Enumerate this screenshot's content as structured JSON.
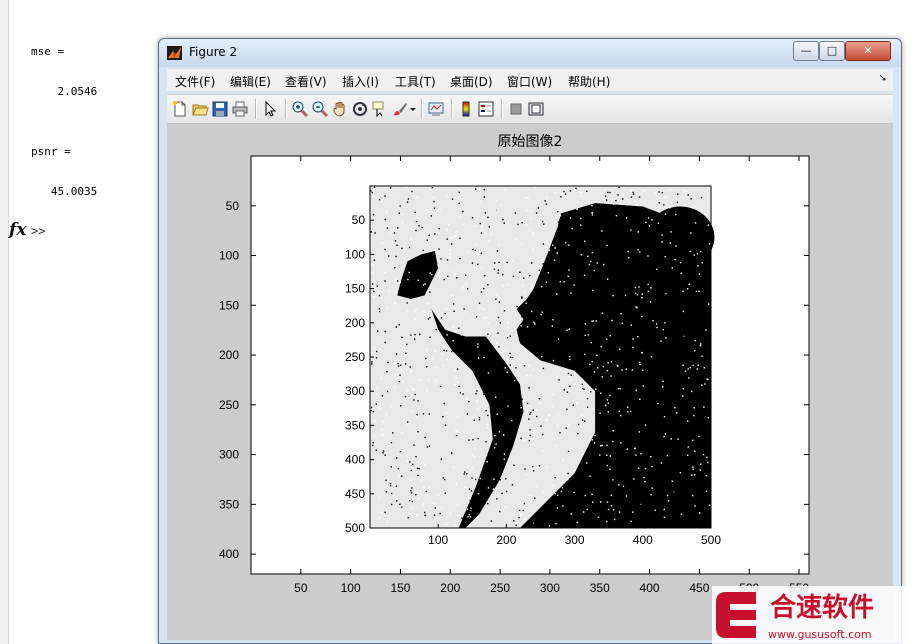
{
  "command_window": {
    "lines": [
      {
        "text": "mse ="
      },
      {
        "text": "    2.0546"
      },
      {
        "text": "psnr ="
      },
      {
        "text": "   45.0035"
      }
    ],
    "fx_label": "fx",
    "prompt": ">>"
  },
  "figure": {
    "title": "Figure 2",
    "menus": [
      "文件(F)",
      "编辑(E)",
      "查看(V)",
      "插入(I)",
      "工具(T)",
      "桌面(D)",
      "窗口(W)",
      "帮助(H)"
    ],
    "toolbar_icons": [
      "new-figure-icon",
      "open-file-icon",
      "save-icon",
      "print-icon",
      "pointer-icon",
      "zoom-in-icon",
      "zoom-out-icon",
      "pan-icon",
      "rotate-3d-icon",
      "data-cursor-icon",
      "brush-icon",
      "brush-dropdown-icon",
      "link-plot-icon",
      "insert-colorbar-icon",
      "insert-legend-icon",
      "hide-plot-tools-icon",
      "show-plot-tools-icon"
    ],
    "window_buttons": {
      "minimize": "—",
      "maximize": "□",
      "close": "✕"
    }
  },
  "chart_data": [
    {
      "type": "image",
      "title": "原始图像2",
      "xlabel": "",
      "ylabel": "",
      "xlim": [
        0,
        560
      ],
      "ylim": [
        420,
        0
      ],
      "x_ticks": [
        50,
        100,
        150,
        200,
        250,
        300,
        350,
        400,
        450,
        500,
        550
      ],
      "y_ticks": [
        50,
        100,
        150,
        200,
        250,
        300,
        350,
        400
      ],
      "grid": false
    },
    {
      "type": "image",
      "title": "",
      "xlim": [
        0,
        500
      ],
      "ylim": [
        500,
        0
      ],
      "x_ticks": [
        100,
        200,
        300,
        400,
        500
      ],
      "y_ticks": [
        50,
        100,
        150,
        200,
        250,
        300,
        350,
        400,
        450,
        500
      ],
      "description_colors": {
        "background": "#e8e8e8",
        "silhouette": "#000000"
      }
    }
  ],
  "watermark": {
    "brand_cn": "合速软件",
    "url": "www.gususoft.com",
    "color": "#c8102e"
  }
}
